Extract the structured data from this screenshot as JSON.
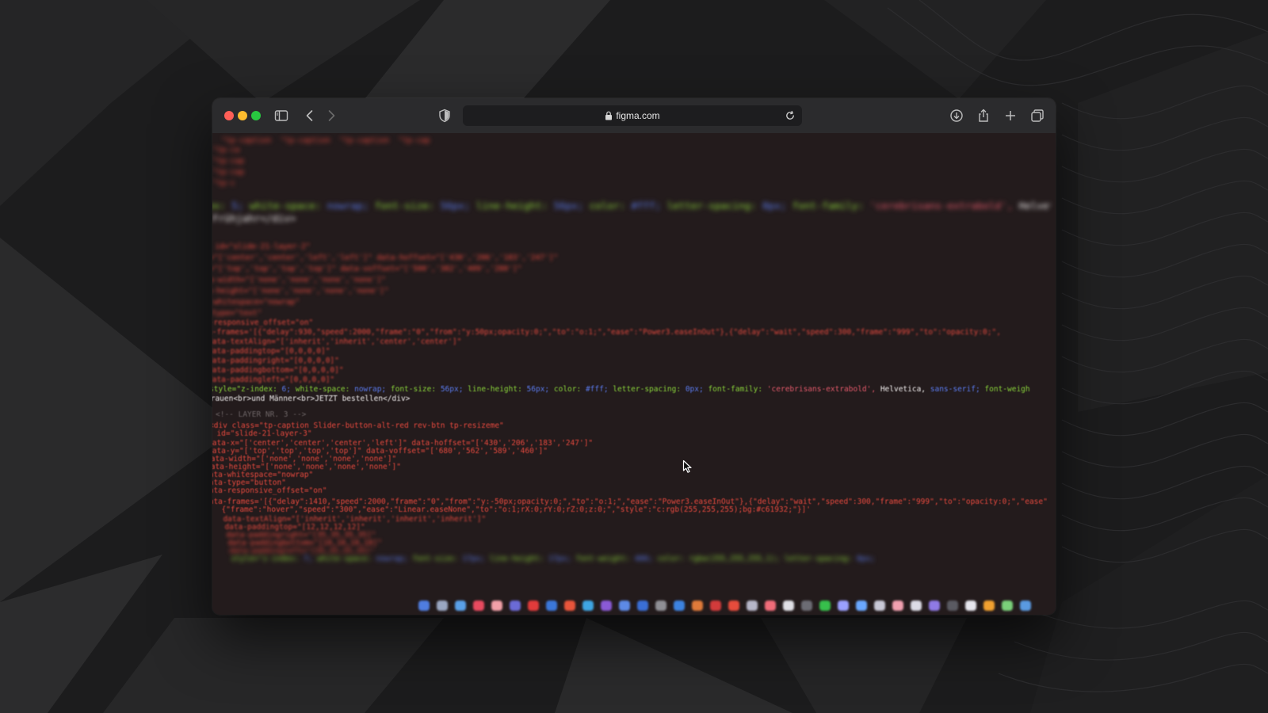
{
  "browser": {
    "url": "figma.com",
    "icons": {
      "sidebar": "sidebar-toggle-icon",
      "back": "chevron-left-icon",
      "forward": "chevron-right-icon",
      "privacy": "shield-icon",
      "lock": "lock-icon",
      "reload": "reload-icon",
      "download": "download-icon",
      "share": "share-icon",
      "new_tab": "plus-icon",
      "tabs": "tab-overview-icon"
    }
  },
  "code": {
    "lines": [
      {
        "text": "  \"tp-caption  \"tp-caption  \"tp-caption  \"tp-cap",
        "color": "red",
        "blur": "blur-3"
      },
      {
        "text": "\"tp-ca",
        "color": "red",
        "blur": "blur-3"
      },
      {
        "text": "\"tp-cap",
        "color": "red",
        "blur": "blur-3"
      },
      {
        "text": "\"tp-cap",
        "color": "red",
        "blur": "blur-3"
      },
      {
        "text": "\"tp-c",
        "color": "red",
        "blur": "blur-3"
      },
      {
        "text": "ex: 5; white-space: nowrap; font-size: 56px; line-height: 56px; color: #fff; letter-spacing: 0px; font-family: 'cerebrisans-extrabold', Helvetica, sans-serif;",
        "color": "mixed",
        "blur": "blur-3",
        "big": true
      },
      {
        "text": "Frühjahr</div>",
        "color": "white",
        "blur": "blur-3",
        "big": true
      },
      {
        "text": "  id=\"slide-21-layer-2\"",
        "color": "red",
        "blur": "blur-2"
      },
      {
        "text": "x=\"['center','center','left','left']\" data-hoffset=\"['430','206','183','247']\"",
        "color": "red",
        "blur": "blur-2"
      },
      {
        "text": "y=\"['top','top','top','top']\" data-voffset=\"['500','382','409','280']\"",
        "color": "red",
        "blur": "blur-2"
      },
      {
        "text": "ta-width=\"['none','none','none','none']\"",
        "color": "red",
        "blur": "blur-2"
      },
      {
        "text": "ta-height=\"['none','none','none','none']\"",
        "color": "red",
        "blur": "blur-2"
      },
      {
        "text": "a-whitespace=\"nowrap\"",
        "color": "red",
        "blur": "blur-2"
      },
      {
        "text": "a-type=\"text\"",
        "color": "red",
        "blur": "blur-2"
      },
      {
        "text": "a-responsive_offset=\"on\"",
        "color": "red",
        "blur": "blur-1"
      },
      {
        "text": "a-frames='[{\"delay\":930,\"speed\":2000,\"frame\":\"0\",\"from\":\"y:50px;opacity:0;\",\"to\":\"o:1;\",\"ease\":\"Power3.easeInOut\"},{\"delay\":\"wait\",\"speed\":300,\"frame\":\"999\",\"to\":\"opacity:0;\",",
        "color": "red",
        "blur": "blur-1"
      },
      {
        "text": "data-textAlign=\"['inherit','inherit','center','center']\"",
        "color": "red",
        "blur": "blur-1"
      },
      {
        "text": "data-paddingtop=\"[0,0,0,0]\"",
        "color": "red",
        "blur": "blur-1"
      },
      {
        "text": "data-paddingright=\"[0,0,0,0]\"",
        "color": "red",
        "blur": "blur-1"
      },
      {
        "text": "data-paddingbottom=\"[0,0,0,0]\"",
        "color": "red",
        "blur": "blur-1"
      },
      {
        "text": "data-paddingleft=\"[0,0,0,0]\"",
        "color": "red",
        "blur": "blur-1"
      },
      {
        "text": "style=\"z-index: 6; white-space: nowrap; font-size: 56px; line-height: 56px; color: #fff; letter-spacing: 0px; font-family: 'cerebrisans-extrabold', Helvetica, sans-serif; font-weigh",
        "color": "mixed",
        "blur": "blur-05"
      },
      {
        "text": "Frauen<br>und Männer<br>JETZT bestellen</div>",
        "color": "white",
        "blur": "blur-05"
      },
      {
        "text": "<!-- LAYER NR. 3 -->",
        "color": "gray",
        "blur": "blur-05"
      },
      {
        "text": "<div class=\"tp-caption Slider-button-alt-red rev-btn tp-resizeme\"",
        "color": "red",
        "blur": "blur-05"
      },
      {
        "text": "  id=\"slide-21-layer-3\"",
        "color": "red",
        "blur": "blur-05"
      },
      {
        "text": "data-x=\"['center','center','center','left']\" data-hoffset=\"['430','206','183','247']\"",
        "color": "red",
        "blur": "blur-05"
      },
      {
        "text": "data-y=\"['top','top','top','top']\" data-voffset=\"['680','562','589','460']\"",
        "color": "red",
        "blur": "blur-05"
      },
      {
        "text": "data-width=\"['none','none','none','none']\"",
        "color": "red",
        "blur": "blur-05"
      },
      {
        "text": "data-height=\"['none','none','none','none']\"",
        "color": "red",
        "blur": "blur-05"
      },
      {
        "text": "data-whitespace=\"nowrap\"",
        "color": "red",
        "blur": "blur-05"
      },
      {
        "text": "data-type=\"button\"",
        "color": "red",
        "blur": "blur-05"
      },
      {
        "text": "data-responsive_offset=\"on\"",
        "color": "red",
        "blur": "blur-05"
      },
      {
        "text": "data-frames='[{\"delay\":1410,\"speed\":2000,\"frame\":\"0\",\"from\":\"y:-50px;opacity:0;\",\"to\":\"o:1;\",\"ease\":\"Power3.easeInOut\"},{\"delay\":\"wait\",\"speed\":300,\"frame\":\"999\",\"to\":\"opacity:0;\",\"ease\":",
        "color": "red",
        "blur": "blur-05"
      },
      {
        "text": "  {\"frame\":\"hover\",\"speed\":\"300\",\"ease\":\"Linear.easeNone\",\"to\":\"o:1;rX:0;rY:0;rZ:0;z:0;\",\"style\":\"c:rgb(255,255,255);bg:#c61932;\"}]'",
        "color": "red",
        "blur": "blur-05"
      },
      {
        "text": "  data-textAlign=\"['inherit','inherit','inherit','inherit']\"",
        "color": "red",
        "blur": "blur-1"
      },
      {
        "text": "  data-paddingtop=\"[12,12,12,12]\"",
        "color": "red",
        "blur": "blur-1"
      },
      {
        "text": "  data-paddingright=\"[35,35,35,35]\"",
        "color": "red",
        "blur": "blur-2"
      },
      {
        "text": "  data-paddingbottom=\"[10,10,10,10]\"",
        "color": "red",
        "blur": "blur-2"
      },
      {
        "text": "  data-paddingleft=\"[35,35,35,35]\"",
        "color": "red",
        "blur": "blur-3"
      },
      {
        "text": "  style=\"z-index: 7; white-space: nowrap; font-size: 17px; line-height: 17px; font-weight: 400; color: rgba(255,255,255,1); letter-spacing: 0px;",
        "color": "mixed",
        "blur": "blur-3"
      }
    ]
  },
  "colors": {
    "window_bg": "#231b1c",
    "toolbar_bg": "#2b2b2d",
    "code_red": "#e84a3f",
    "code_green": "#8ad43b",
    "code_blue": "#5b7cf0",
    "code_purple": "#8b5cf6",
    "code_white": "#f2efef"
  }
}
